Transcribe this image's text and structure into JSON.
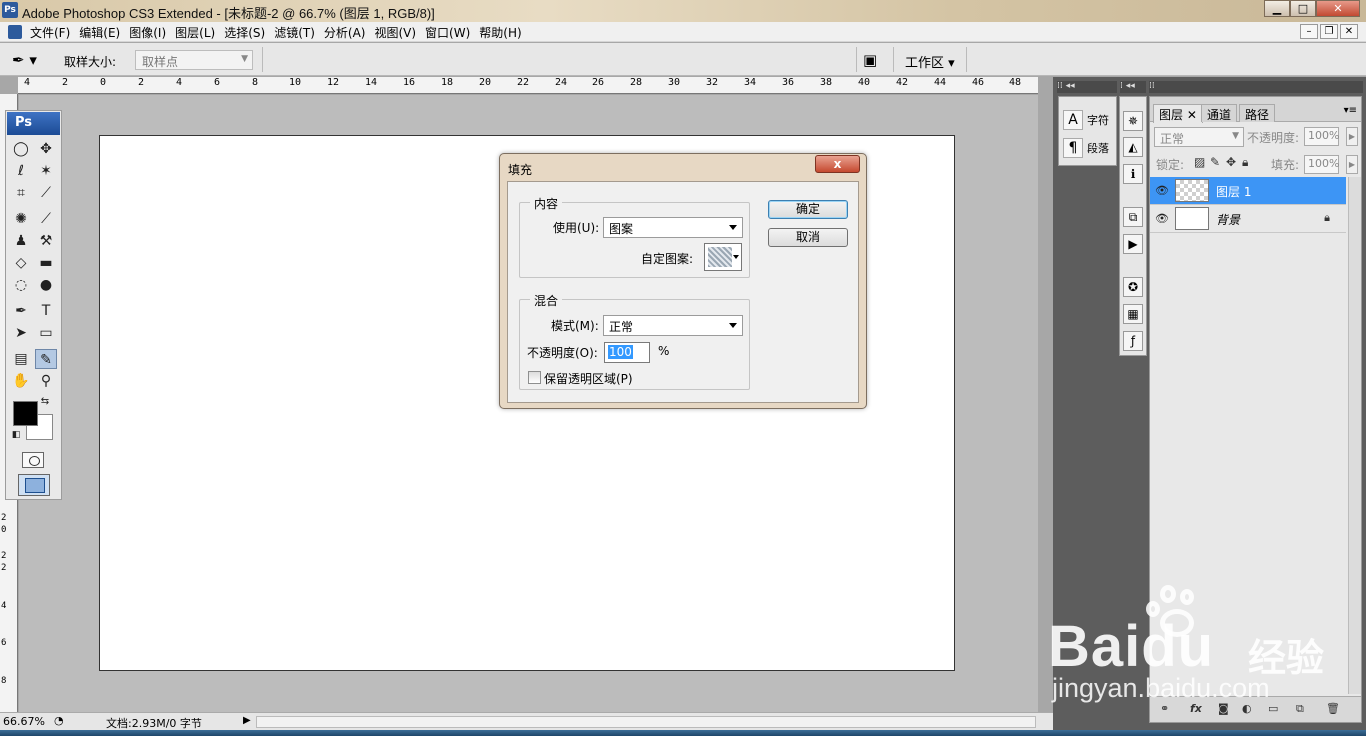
{
  "window": {
    "title": "Adobe Photoshop CS3 Extended - [未标题-2 @ 66.7% (图层 1, RGB/8)]",
    "app_icon": "Ps",
    "controls": [
      "minimize-icon",
      "maximize-icon",
      "close-icon"
    ]
  },
  "menu": {
    "items": [
      "文件(F)",
      "编辑(E)",
      "图像(I)",
      "图层(L)",
      "选择(S)",
      "滤镜(T)",
      "分析(A)",
      "视图(V)",
      "窗口(W)",
      "帮助(H)"
    ]
  },
  "options": {
    "tool_icon": "eyedropper-icon",
    "sample_size_label": "取样大小:",
    "sample_size_value": "取样点",
    "workspace_label": "工作区 ▾"
  },
  "ruler": {
    "top_ticks": [
      "4",
      "2",
      "0",
      "2",
      "4",
      "6",
      "8",
      "10",
      "12",
      "14",
      "16",
      "18",
      "20",
      "22",
      "24",
      "26",
      "28",
      "30",
      "32",
      "34",
      "36",
      "38",
      "40",
      "42",
      "44",
      "46",
      "48"
    ],
    "left_ticks": [
      "2",
      "0",
      "2",
      "2",
      "4",
      "6",
      "8"
    ]
  },
  "toolbox": {
    "logo": "Ps"
  },
  "dialog": {
    "title": "填充",
    "close_label": "x",
    "content_group": "内容",
    "use_label": "使用(U):",
    "use_value": "图案",
    "custom_pattern_label": "自定图案:",
    "blend_group": "混合",
    "mode_label": "模式(M):",
    "mode_value": "正常",
    "opacity_label": "不透明度(O):",
    "opacity_value": "100",
    "opacity_unit": "%",
    "preserve_label": "保留透明区域(P)",
    "preserve_checked": false,
    "ok_label": "确定",
    "cancel_label": "取消"
  },
  "char_panel": {
    "char_label": "字符",
    "para_label": "段落"
  },
  "layers_panel": {
    "tabs": [
      "图层",
      "通道",
      "路径"
    ],
    "blend_mode": "正常",
    "opacity_label": "不透明度:",
    "opacity_value": "100%",
    "lock_label": "锁定:",
    "fill_label": "填充:",
    "fill_value": "100%",
    "layers": [
      {
        "name": "图层 1",
        "selected": true,
        "locked": false
      },
      {
        "name": "背景",
        "selected": false,
        "locked": true
      }
    ]
  },
  "status": {
    "zoom": "66.67%",
    "doc": "文档:2.93M/0 字节"
  },
  "watermark": {
    "brand": "Baidu",
    "cn": "经验",
    "url": "jingyan.baidu.com"
  }
}
